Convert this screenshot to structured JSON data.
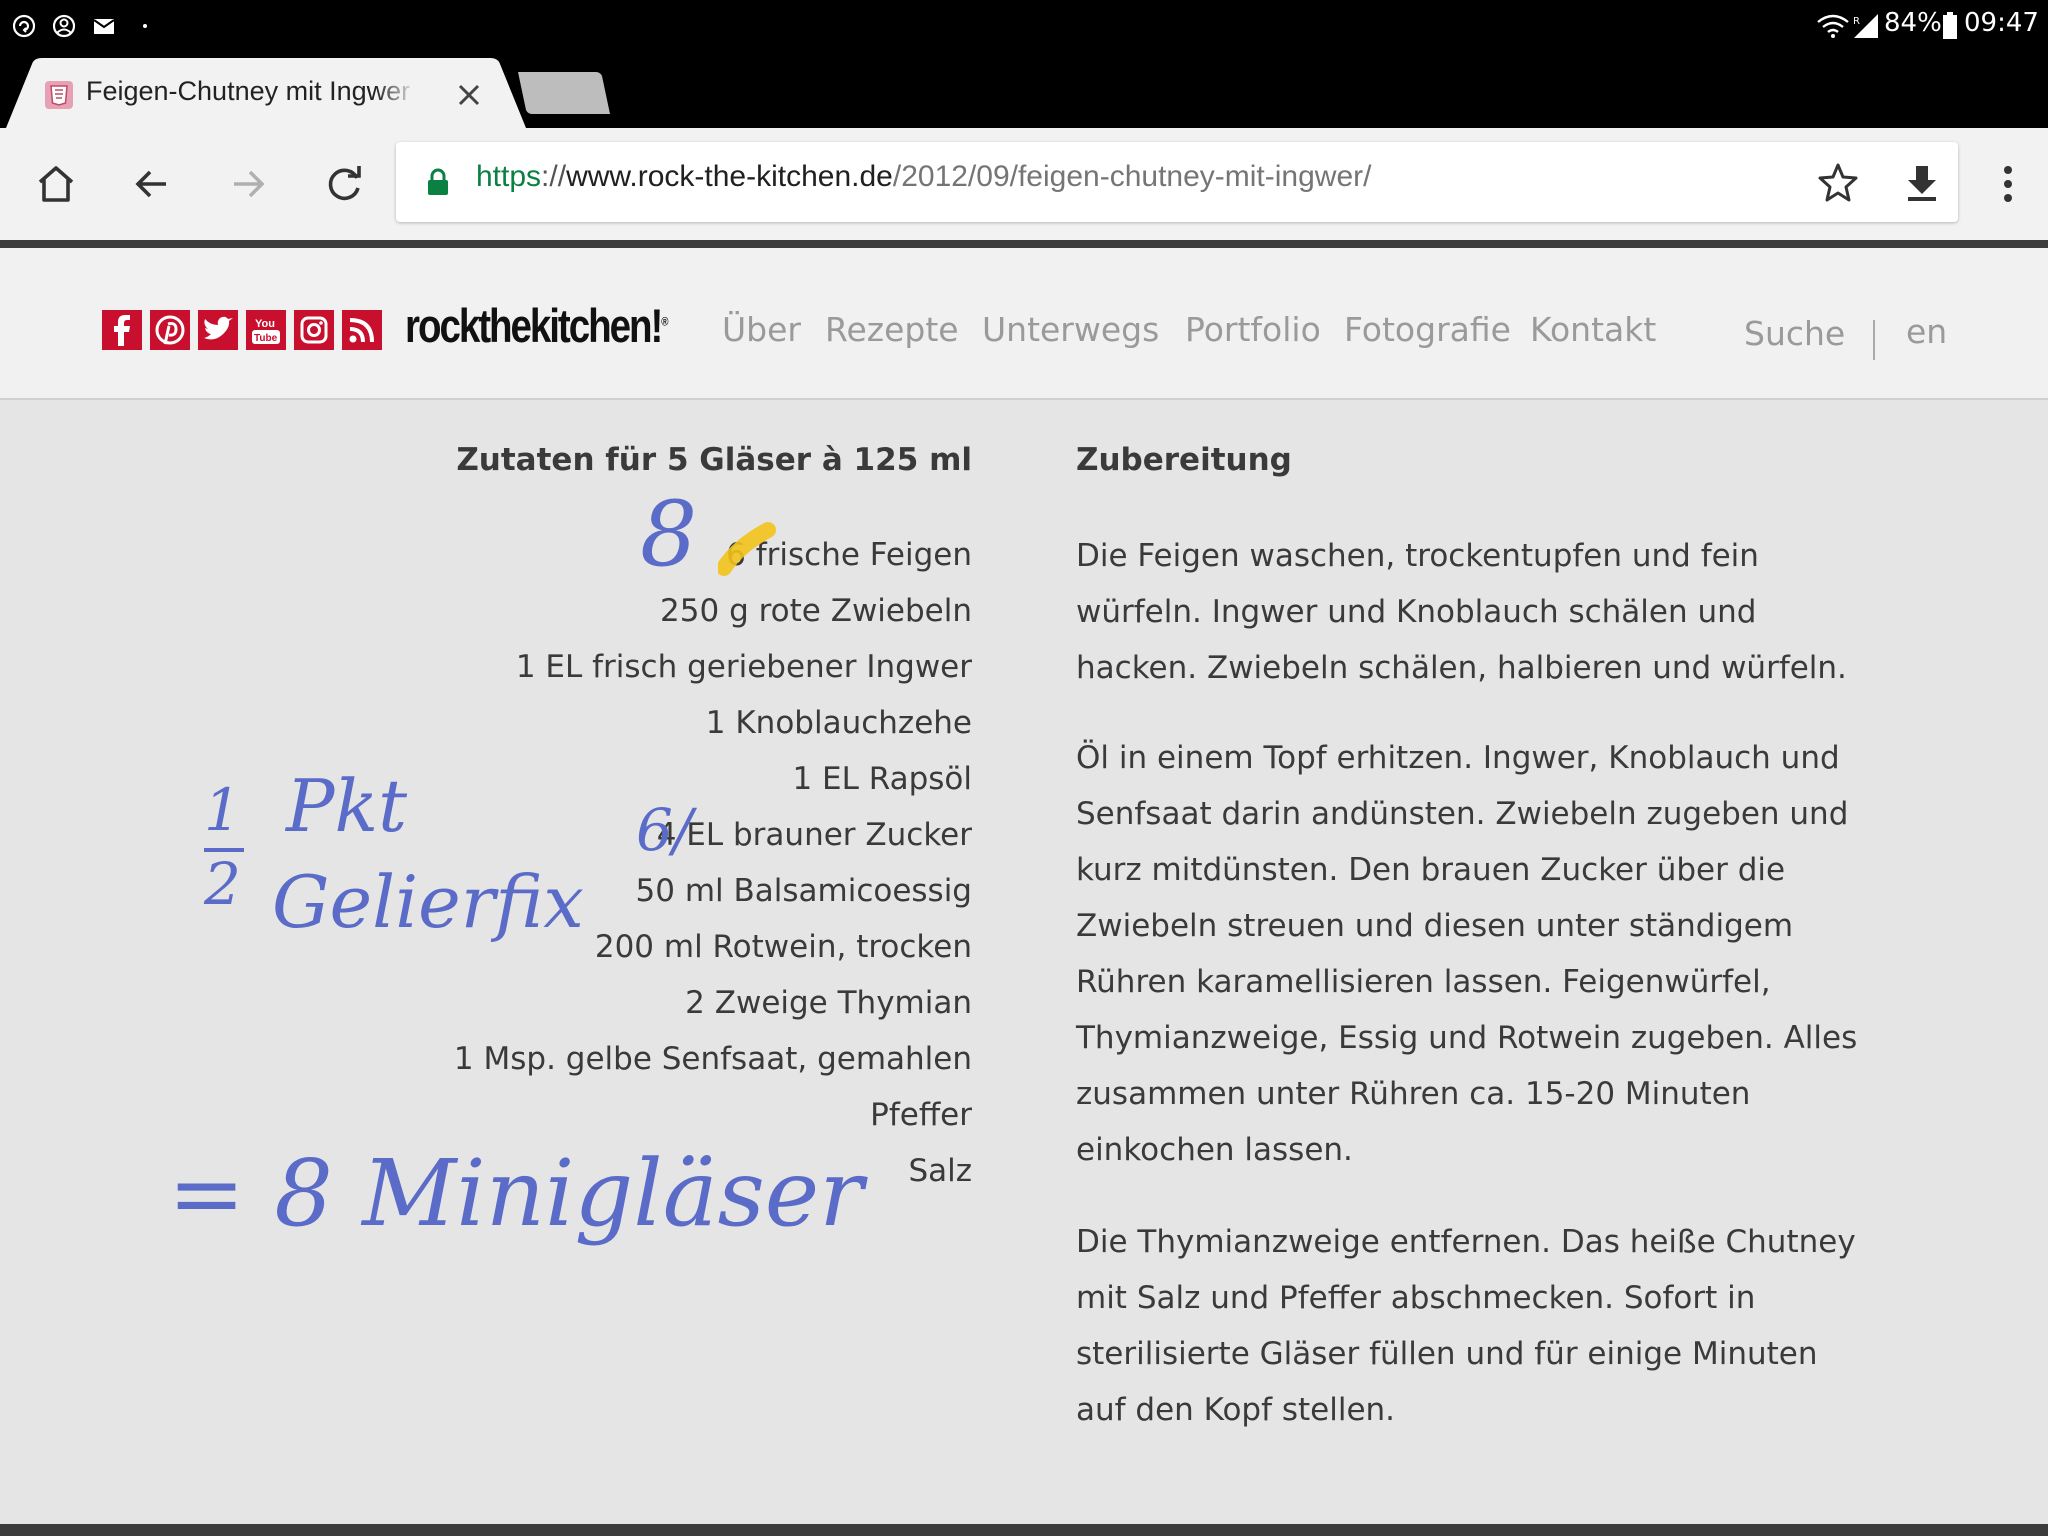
{
  "status_bar": {
    "battery": "84%",
    "time": "09:47",
    "icons": [
      "sync-icon",
      "account-circle-icon",
      "mail-icon",
      "wifi-icon",
      "signal-icon",
      "battery-icon"
    ]
  },
  "tab": {
    "title": "Feigen-Chutney mit Ingwer | ro",
    "favicon": "html5-icon"
  },
  "toolbar": {
    "url_scheme": "https",
    "url_sep": "://",
    "url_host": "www.rock-the-kitchen.de",
    "url_path": "/2012/09/feigen-chutney-mit-ingwer/"
  },
  "site": {
    "logo": "rockthekitchen!",
    "logo_mark": "®",
    "social": [
      "facebook-icon",
      "pinterest-icon",
      "twitter-icon",
      "youtube-icon",
      "instagram-icon",
      "rss-icon"
    ],
    "youtube_text_top": "You",
    "youtube_text_bottom": "Tube",
    "nav": [
      "Über",
      "Rezepte",
      "Unterwegs",
      "Portfolio",
      "Fotografie",
      "Kontakt"
    ],
    "search": "Suche",
    "lang": "en"
  },
  "ingredients": {
    "title": "Zutaten für 5 Gläser à 125 ml",
    "items": [
      "6 frische Feigen",
      "250 g rote Zwiebeln",
      "1 EL frisch geriebener Ingwer",
      "1 Knoblauchzehe",
      "1 EL Rapsöl",
      "4 EL brauner Zucker",
      "50 ml Balsamicoessig",
      "200 ml Rotwein, trocken",
      "2 Zweige Thymian",
      "1 Msp. gelbe Senfsaat, gemahlen",
      "Pfeffer",
      "Salz"
    ]
  },
  "preparation": {
    "title": "Zubereitung",
    "paragraphs": [
      "Die Feigen waschen, trockentupfen und fein würfeln. Ingwer und Knoblauch schälen und hacken. Zwiebeln schälen, halbieren und würfeln.",
      "Öl in einem Topf erhitzen. Ingwer, Knoblauch und Senfsaat darin andünsten. Zwiebeln zugeben und kurz mitdünsten. Den brauen Zucker über die Zwiebeln streuen und diesen unter ständigem Rühren karamellisieren lassen. Feigenwürfel, Thymianzweige, Essig und Rotwein zugeben. Alles zusammen unter Rühren ca. 15-20 Minuten einkochen lassen.",
      "Die Thymianzweige entfernen. Das heiße Chutney mit Salz und Pfeffer abschmecken. Sofort in sterilisierte Gläser füllen und für einige Minuten auf den Kopf stellen."
    ]
  },
  "annotations": {
    "figs": "8",
    "sugar": "6/",
    "frac_num": "1",
    "frac_den": "2",
    "pkg": "Pkt",
    "gelier": "Gelierfix",
    "result": "= 8 Minigläser"
  },
  "colors": {
    "ink": "#5b6bc8",
    "highlighter": "#f2c21b",
    "social_red": "#c8102e",
    "url_green": "#0b8043"
  }
}
